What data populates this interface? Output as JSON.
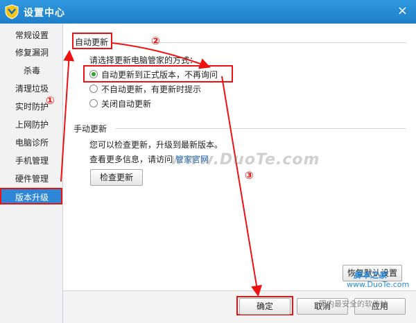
{
  "window": {
    "title": "设置中心",
    "close_glyph": "×"
  },
  "icons": {
    "logo": "shield-logo-icon",
    "close": "close-icon"
  },
  "sidebar": {
    "items": [
      {
        "label": "常规设置"
      },
      {
        "label": "修复漏洞"
      },
      {
        "label": "杀毒"
      },
      {
        "label": "清理垃圾"
      },
      {
        "label": "实时防护"
      },
      {
        "label": "上网防护"
      },
      {
        "label": "电脑诊所"
      },
      {
        "label": "手机管理"
      },
      {
        "label": "硬件管理"
      },
      {
        "label": "版本升级",
        "active": true
      }
    ]
  },
  "auto_update": {
    "title": "自动更新",
    "prompt": "请选择更新电脑管家的方式：",
    "options": [
      {
        "label": "自动更新到正式版本，不再询问",
        "selected": true
      },
      {
        "label": "不自动更新，有更新时提示",
        "selected": false
      },
      {
        "label": "关闭自动更新",
        "selected": false
      }
    ]
  },
  "manual_update": {
    "title": "手动更新",
    "line1": "您可以检查更新，升级到最新版本。",
    "line2_prefix": "查看更多信息，请访问",
    "link_label": "管家官网",
    "check_button": "检查更新"
  },
  "footer": {
    "restore_button": "恢复默认设置",
    "ok_button": "确定",
    "cancel_button": "取消",
    "apply_button": "应用"
  },
  "annotations": {
    "step1": "①",
    "step2": "②",
    "step3": "③"
  },
  "watermarks": {
    "main": "www.DuoTe.com",
    "logo_text": "脚本之家",
    "logo_url": "www.DuoTe.com",
    "bottom": "国内最安全的软件站"
  },
  "colors": {
    "titlebar": "#1f7fc8",
    "active_nav": "#2e86d6",
    "annotation_red": "#ee1111",
    "radio_selected": "#2aa82a",
    "link": "#1a6fc9"
  }
}
